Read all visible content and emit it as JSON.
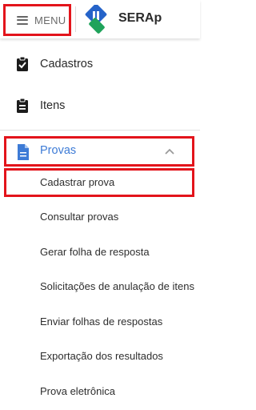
{
  "header": {
    "menu_label": "MENU",
    "brand": "SERAp"
  },
  "nav": {
    "cadastros": "Cadastros",
    "itens": "Itens",
    "provas": "Provas"
  },
  "provas_menu": [
    "Cadastrar prova",
    "Consultar provas",
    "Gerar folha de resposta",
    "Solicitações de anulação de itens",
    "Enviar folhas de respostas",
    "Exportação dos resultados",
    "Prova eletrônica"
  ],
  "icons": {
    "menu": "hamburger-icon",
    "cadastros": "clipboard-check-icon",
    "itens": "clipboard-list-icon",
    "provas": "document-icon",
    "expand": "chevron-up-icon"
  },
  "colors": {
    "highlight": "#e3141b",
    "active": "#3d7bd6",
    "logo_blue": "#2563c9",
    "logo_green": "#1fa35b"
  }
}
